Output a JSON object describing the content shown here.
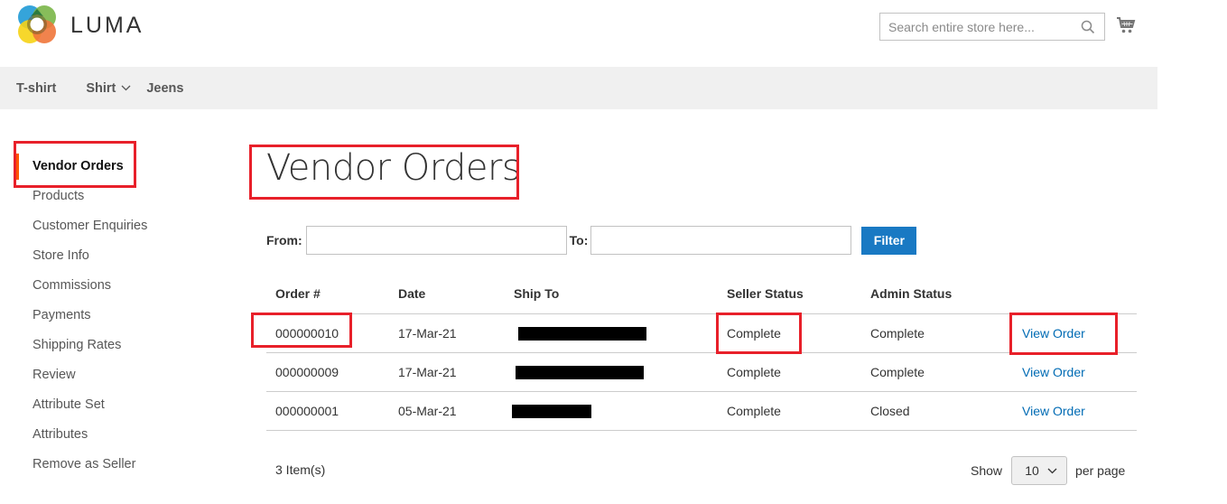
{
  "header": {
    "brand": "LUMA",
    "logo_icon": "luma-logo-icon",
    "search": {
      "placeholder": "Search entire store here...",
      "value": "",
      "icon": "search-icon"
    },
    "cart_icon": "cart-icon"
  },
  "nav": {
    "items": [
      {
        "label": "T-shirt",
        "has_submenu": false
      },
      {
        "label": "Shirt",
        "has_submenu": true
      },
      {
        "label": "Jeens",
        "has_submenu": false
      }
    ]
  },
  "sidebar": {
    "active": "Vendor Orders",
    "items": [
      {
        "label": "Vendor Orders"
      },
      {
        "label": "Products"
      },
      {
        "label": "Customer Enquiries"
      },
      {
        "label": "Store Info"
      },
      {
        "label": "Commissions"
      },
      {
        "label": "Payments"
      },
      {
        "label": "Shipping Rates"
      },
      {
        "label": "Review"
      },
      {
        "label": "Attribute Set"
      },
      {
        "label": "Attributes"
      },
      {
        "label": "Remove as Seller"
      }
    ]
  },
  "main": {
    "title": "Vendor Orders",
    "filter": {
      "from_label": "From:",
      "from_value": "",
      "to_label": "To:",
      "to_value": "",
      "button_label": "Filter"
    },
    "table": {
      "columns": [
        "Order #",
        "Date",
        "Ship To",
        "Seller Status",
        "Admin Status",
        ""
      ],
      "rows": [
        {
          "order": "000000010",
          "date": "17-Mar-21",
          "ship_to": "[redacted]",
          "seller_status": "Complete",
          "admin_status": "Complete",
          "action": "View Order"
        },
        {
          "order": "000000009",
          "date": "17-Mar-21",
          "ship_to": "[redacted]",
          "seller_status": "Complete",
          "admin_status": "Complete",
          "action": "View Order"
        },
        {
          "order": "000000001",
          "date": "05-Mar-21",
          "ship_to": "[redacted]",
          "seller_status": "Complete",
          "admin_status": "Closed",
          "action": "View Order"
        }
      ]
    },
    "footer": {
      "items_count": "3 Item(s)",
      "show_label": "Show",
      "per_page_value": "10",
      "per_page_label": "per page"
    }
  },
  "colors": {
    "accent_blue": "#1979c3",
    "link_blue": "#006bb4",
    "active_marker": "#ff5501",
    "highlight_red": "#e8202a",
    "nav_bg": "#f0f0f0"
  }
}
